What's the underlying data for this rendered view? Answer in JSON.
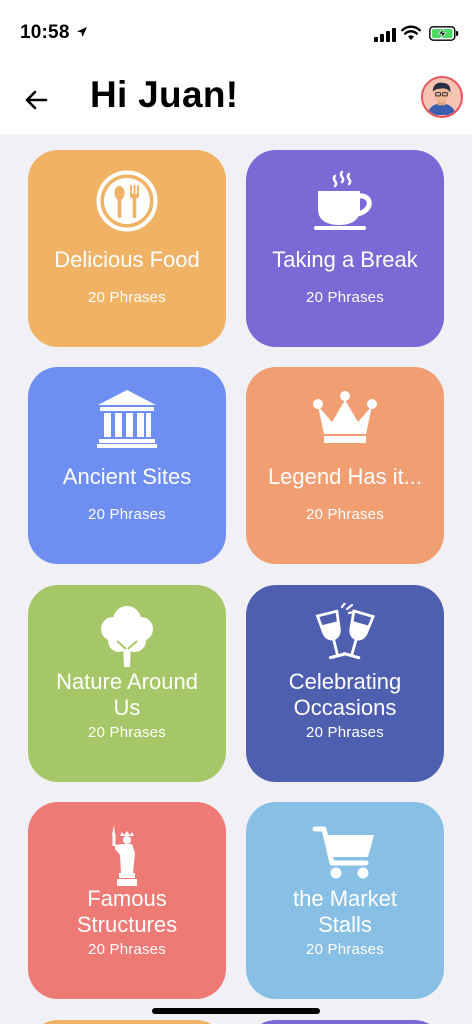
{
  "status_bar": {
    "time": "10:58"
  },
  "header": {
    "title": "Hi Juan!"
  },
  "colors": {
    "food": "#f0b265",
    "break": "#7b6ad6",
    "ancient": "#6e8ef2",
    "legend": "#f19e73",
    "nature": "#a6c767",
    "celebrate": "#4f5fb0",
    "famous": "#ee7a75",
    "market": "#87c0e4",
    "avatar_border": "#e8545b"
  },
  "cards": [
    {
      "title": "Delicious Food",
      "subtitle": "20 Phrases",
      "icon": "fork-spoon-icon"
    },
    {
      "title": "Taking a Break",
      "subtitle": "20 Phrases",
      "icon": "coffee-cup-icon"
    },
    {
      "title": "Ancient Sites",
      "subtitle": "20 Phrases",
      "icon": "temple-icon"
    },
    {
      "title": "Legend Has it...",
      "subtitle": "20 Phrases",
      "icon": "crown-icon"
    },
    {
      "title_line1": "Nature Around",
      "title_line2": "Us",
      "subtitle": "20 Phrases",
      "icon": "tree-icon"
    },
    {
      "title_line1": "Celebrating",
      "title_line2": "Occasions",
      "subtitle": "20 Phrases",
      "icon": "wine-glasses-icon"
    },
    {
      "title_line1": "Famous",
      "title_line2": "Structures",
      "subtitle": "20 Phrases",
      "icon": "statue-of-liberty-icon"
    },
    {
      "title_line1": "the Market",
      "title_line2": "Stalls",
      "subtitle": "20 Phrases",
      "icon": "shopping-cart-icon"
    }
  ]
}
